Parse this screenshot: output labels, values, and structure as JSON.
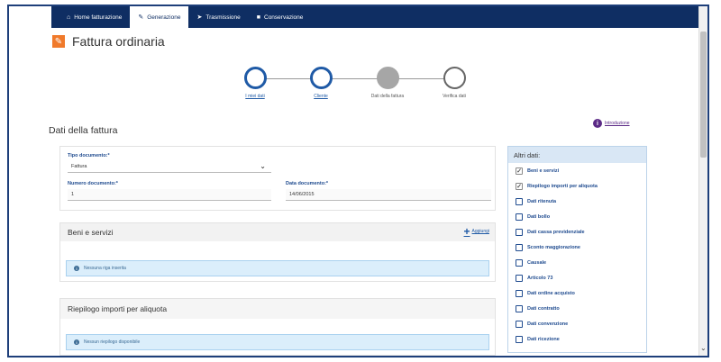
{
  "nav": {
    "items": [
      {
        "label": "Home fatturazione",
        "icon": "home-icon"
      },
      {
        "label": "Generazione",
        "icon": "pencil-icon",
        "active": true
      },
      {
        "label": "Trasmissione",
        "icon": "send-icon"
      },
      {
        "label": "Conservazione",
        "icon": "archive-icon"
      }
    ]
  },
  "page": {
    "title": "Fattura ordinaria",
    "section_title": "Dati della fattura",
    "help_label": "Introduzione"
  },
  "steps": [
    {
      "label": "I miei dati",
      "state": "done"
    },
    {
      "label": "Cliente",
      "state": "done"
    },
    {
      "label": "Dati della fattura",
      "state": "current"
    },
    {
      "label": "Verifica dati",
      "state": "todo"
    }
  ],
  "form": {
    "tipo_label": "Tipo documento:*",
    "tipo_value": "Fattura",
    "numero_label": "Numero documento:*",
    "numero_value": "1",
    "data_label": "Data documento:*",
    "data_value": "14/06/2015"
  },
  "beni": {
    "title": "Beni e servizi",
    "add_label": "Aggiungi",
    "alert": "Nessuna riga inserita"
  },
  "riepilogo": {
    "title": "Riepilogo importi per aliquota",
    "alert": "Nessun riepilogo disponibile"
  },
  "side": {
    "title": "Altri dati:",
    "items": [
      {
        "label": "Beni e servizi",
        "checked": true
      },
      {
        "label": "Riepilogo importi per aliquota",
        "checked": true
      },
      {
        "label": "Dati ritenuta",
        "checked": false
      },
      {
        "label": "Dati bollo",
        "checked": false
      },
      {
        "label": "Dati cassa previdenziale",
        "checked": false
      },
      {
        "label": "Sconto maggiorazione",
        "checked": false
      },
      {
        "label": "Causale",
        "checked": false
      },
      {
        "label": "Articolo 73",
        "checked": false
      },
      {
        "label": "Dati ordine acquisto",
        "checked": false
      },
      {
        "label": "Dati contratto",
        "checked": false
      },
      {
        "label": "Dati convenzione",
        "checked": false
      },
      {
        "label": "Dati ricezione",
        "checked": false
      }
    ]
  },
  "colors": {
    "nav_bg": "#0f2e63",
    "accent": "#1f5aa6",
    "edit_badge": "#f07a2b",
    "alert_bg": "#dbeefb"
  }
}
